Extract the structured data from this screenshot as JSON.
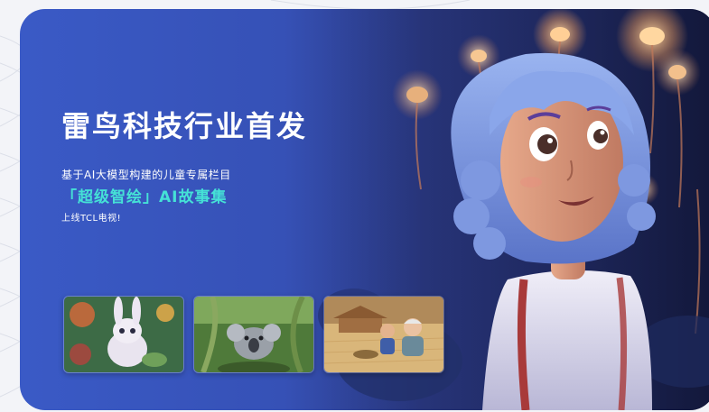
{
  "banner": {
    "headline": "雷鸟科技行业首发",
    "subtitle": "基于AI大模型构建的儿童专属栏目",
    "highlight": "「超级智绘」AI故事集",
    "launch_note": "上线TCL电视!"
  },
  "thumbnails": [
    {
      "icon": "bunny-illustration"
    },
    {
      "icon": "koala-illustration"
    },
    {
      "icon": "grandpa-child-illustration"
    }
  ],
  "hero": {
    "icon": "curly-hair-girl-illustration"
  },
  "colors": {
    "banner_blue": "#3651b6",
    "highlight_teal": "#45e1d6",
    "text_white": "#ffffff"
  }
}
